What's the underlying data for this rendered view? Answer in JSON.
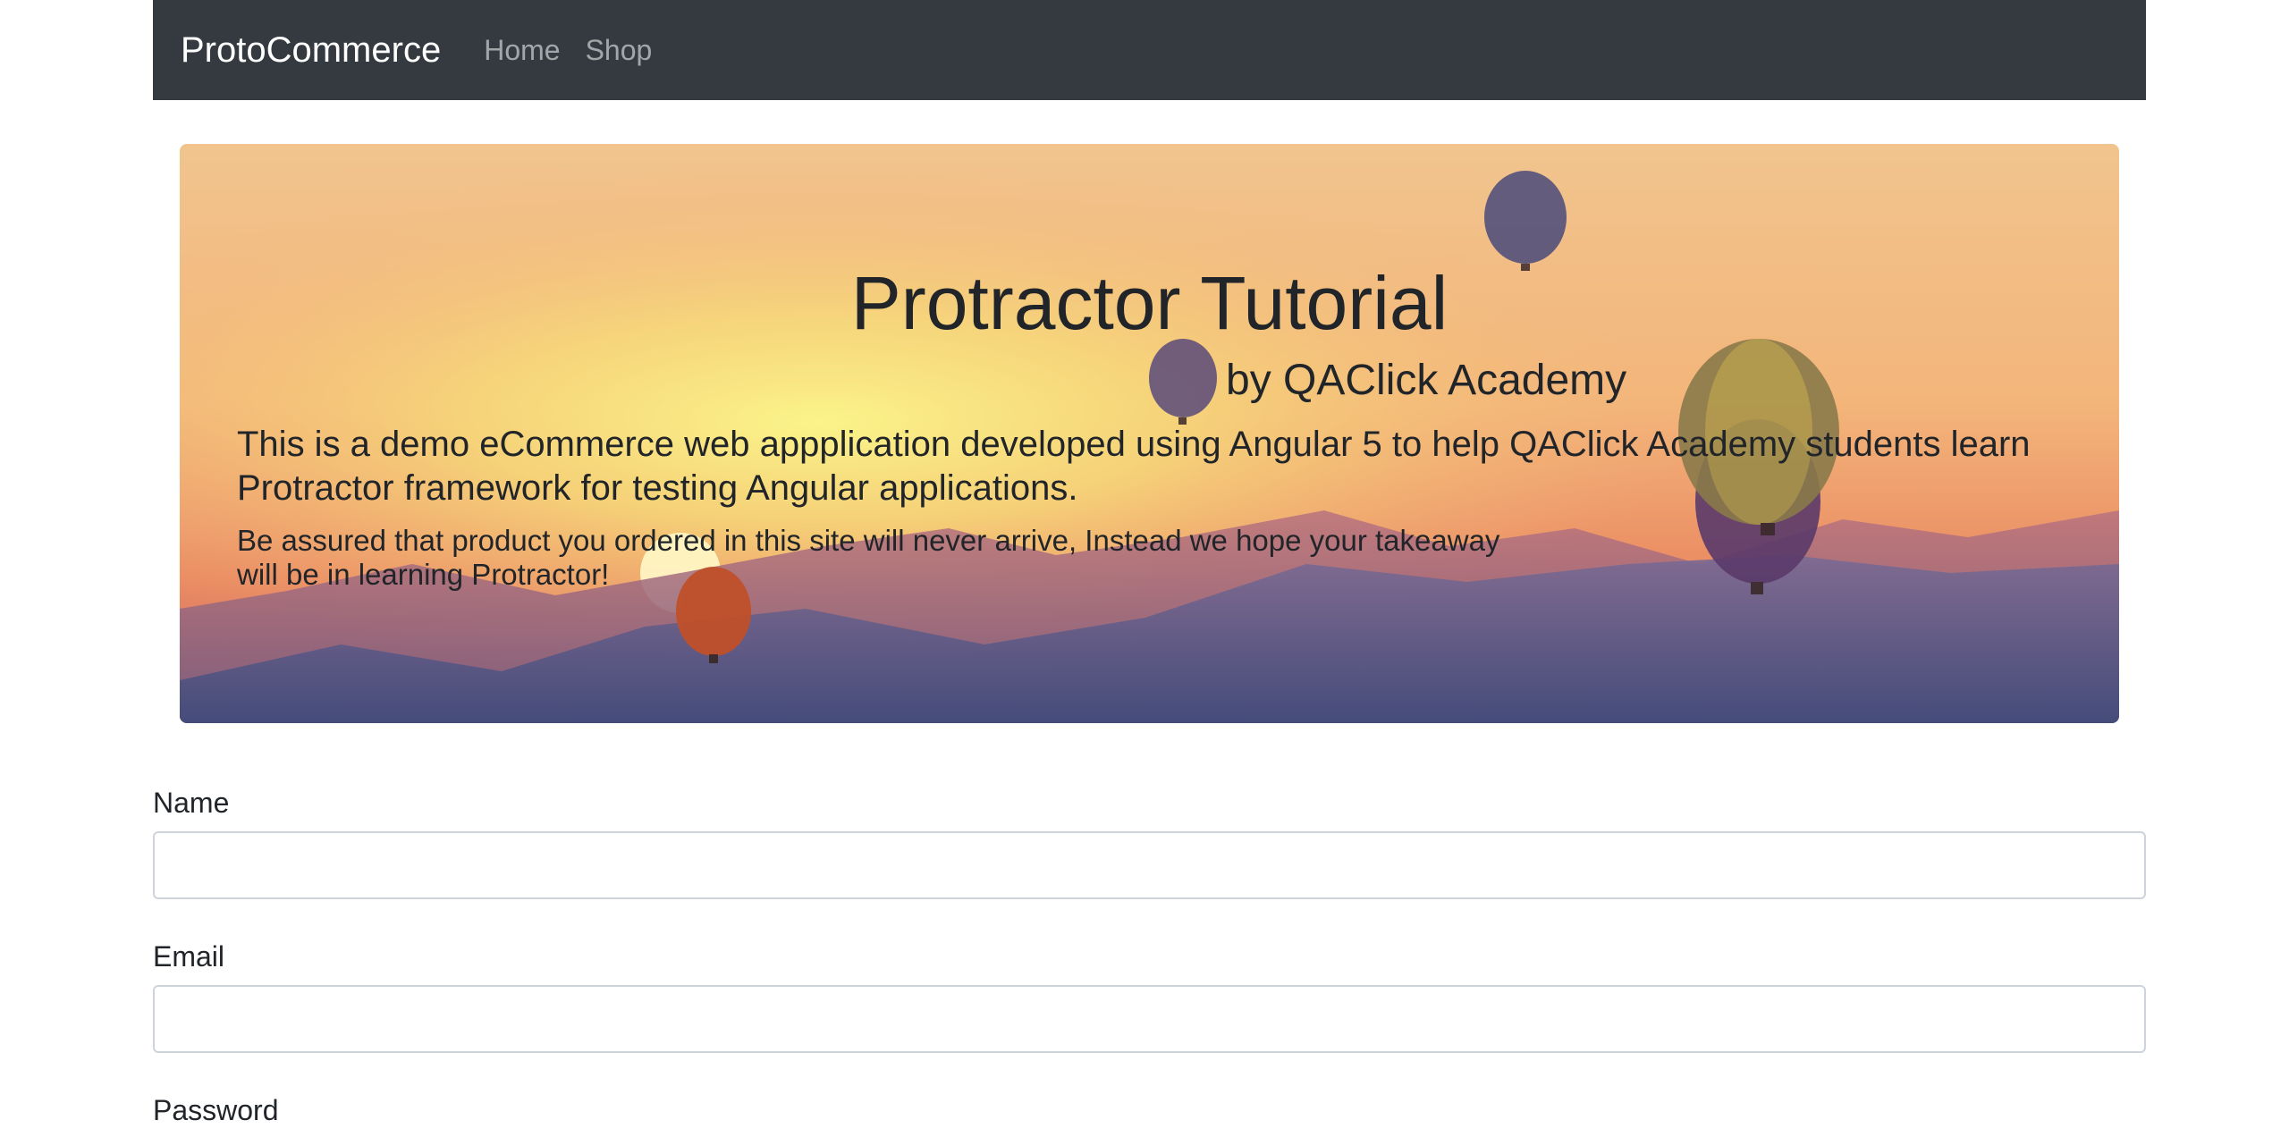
{
  "navbar": {
    "brand": "ProtoCommerce",
    "links": [
      {
        "label": "Home"
      },
      {
        "label": "Shop"
      }
    ]
  },
  "jumbotron": {
    "title": "Protractor Tutorial",
    "subtitle": "by QAClick Academy",
    "lead": "This is a demo eCommerce web appplication developed using Angular 5 to help QAClick Academy students learn Protractor framework for testing Angular applications.",
    "note": "Be assured that product you ordered in this site will never arrive, Instead we hope your takeaway will be in learning Protractor!"
  },
  "form": {
    "name": {
      "label": "Name",
      "value": ""
    },
    "email": {
      "label": "Email",
      "value": ""
    },
    "password": {
      "label": "Password"
    }
  },
  "colors": {
    "navbar_bg": "#343a40",
    "sky_top": "#f3c98f",
    "sun_glow": "#f8ec80",
    "mountain": "#5a5a8a"
  }
}
